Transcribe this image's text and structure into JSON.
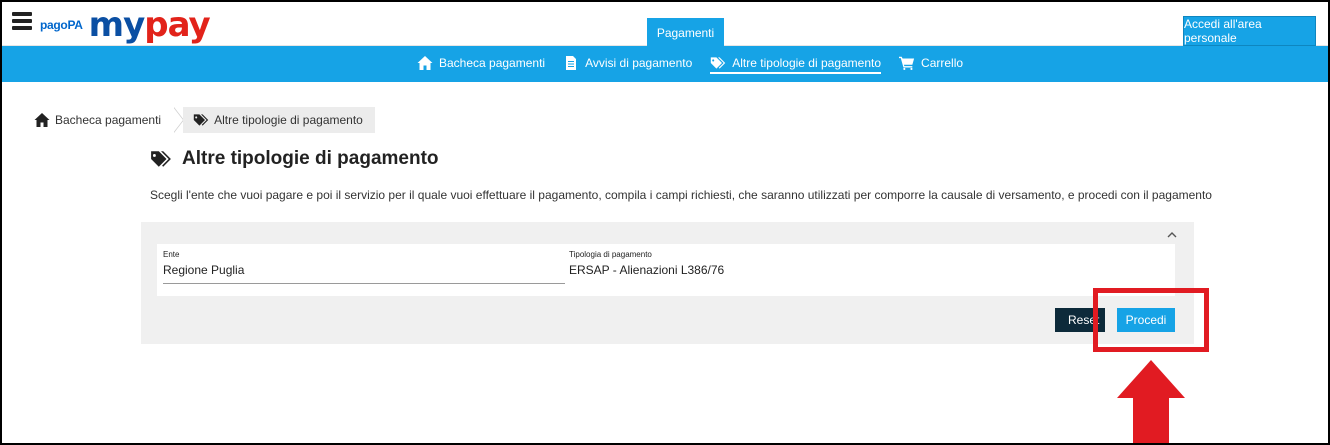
{
  "header": {
    "logo_pagopa": "pagoPA",
    "logo_my": "my",
    "logo_pay": "pay",
    "active_tab": "Pagamenti",
    "login_label": "Accedi all'area personale"
  },
  "nav": {
    "items": [
      {
        "label": "Bacheca pagamenti",
        "icon": "home-icon"
      },
      {
        "label": "Avvisi di pagamento",
        "icon": "document-icon"
      },
      {
        "label": "Altre tipologie di pagamento",
        "icon": "tags-icon",
        "active": true
      },
      {
        "label": "Carrello",
        "icon": "cart-icon"
      }
    ]
  },
  "breadcrumb": {
    "items": [
      {
        "label": "Bacheca pagamenti",
        "icon": "home-icon"
      },
      {
        "label": "Altre tipologie di pagamento",
        "icon": "tags-icon"
      }
    ]
  },
  "page": {
    "title": "Altre tipologie di pagamento",
    "intro": "Scegli l'ente che vuoi pagare e poi il servizio per il quale vuoi effettuare il pagamento, compila i campi richiesti, che saranno utilizzati per comporre la causale di versamento, e procedi con il pagamento"
  },
  "form": {
    "collapse_icon": "chevron-up-icon",
    "ente": {
      "label": "Ente",
      "value": "Regione Puglia"
    },
    "tipologia": {
      "label": "Tipologia di pagamento",
      "value": "ERSAP - Alienazioni L386/76"
    },
    "reset_label": "Reset",
    "procedi_label": "Procedi"
  },
  "colors": {
    "accent": "#16a3e6",
    "dark_button": "#0d2a3a",
    "annotation": "#e11b22",
    "brand_blue": "#0b4fa3",
    "brand_red": "#e2231a"
  }
}
